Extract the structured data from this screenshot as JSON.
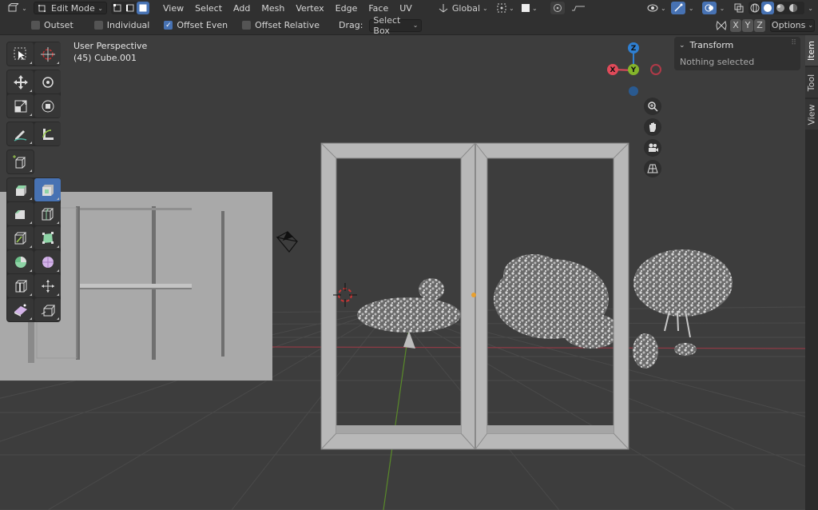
{
  "header": {
    "mode_label": "Edit Mode",
    "menus": [
      "View",
      "Select",
      "Add",
      "Mesh",
      "Vertex",
      "Edge",
      "Face",
      "UV"
    ],
    "transform_orientation": "Global"
  },
  "tool_options": {
    "outset": {
      "label": "Outset",
      "checked": false
    },
    "individual": {
      "label": "Individual",
      "checked": false
    },
    "offset_even": {
      "label": "Offset Even",
      "checked": true
    },
    "offset_relative": {
      "label": "Offset Relative",
      "checked": false
    },
    "drag_label": "Drag:",
    "drag_value": "Select Box",
    "axes": [
      "X",
      "Y",
      "Z"
    ],
    "options_label": "Options"
  },
  "viewport": {
    "perspective": "User Perspective",
    "object": "(45) Cube.001"
  },
  "gizmo": {
    "z": "Z",
    "y": "Y",
    "x": "X"
  },
  "sidebar": {
    "panel_title": "Transform",
    "panel_text": "Nothing selected",
    "tabs": [
      "Item",
      "Tool",
      "View"
    ]
  },
  "colors": {
    "accent": "#4772b3",
    "x_axis": "#e04a59",
    "y_axis": "#84b52b",
    "z_axis": "#2f7fd1",
    "grid_red": "#8f3a45",
    "grid_green": "#5a8a2a"
  }
}
